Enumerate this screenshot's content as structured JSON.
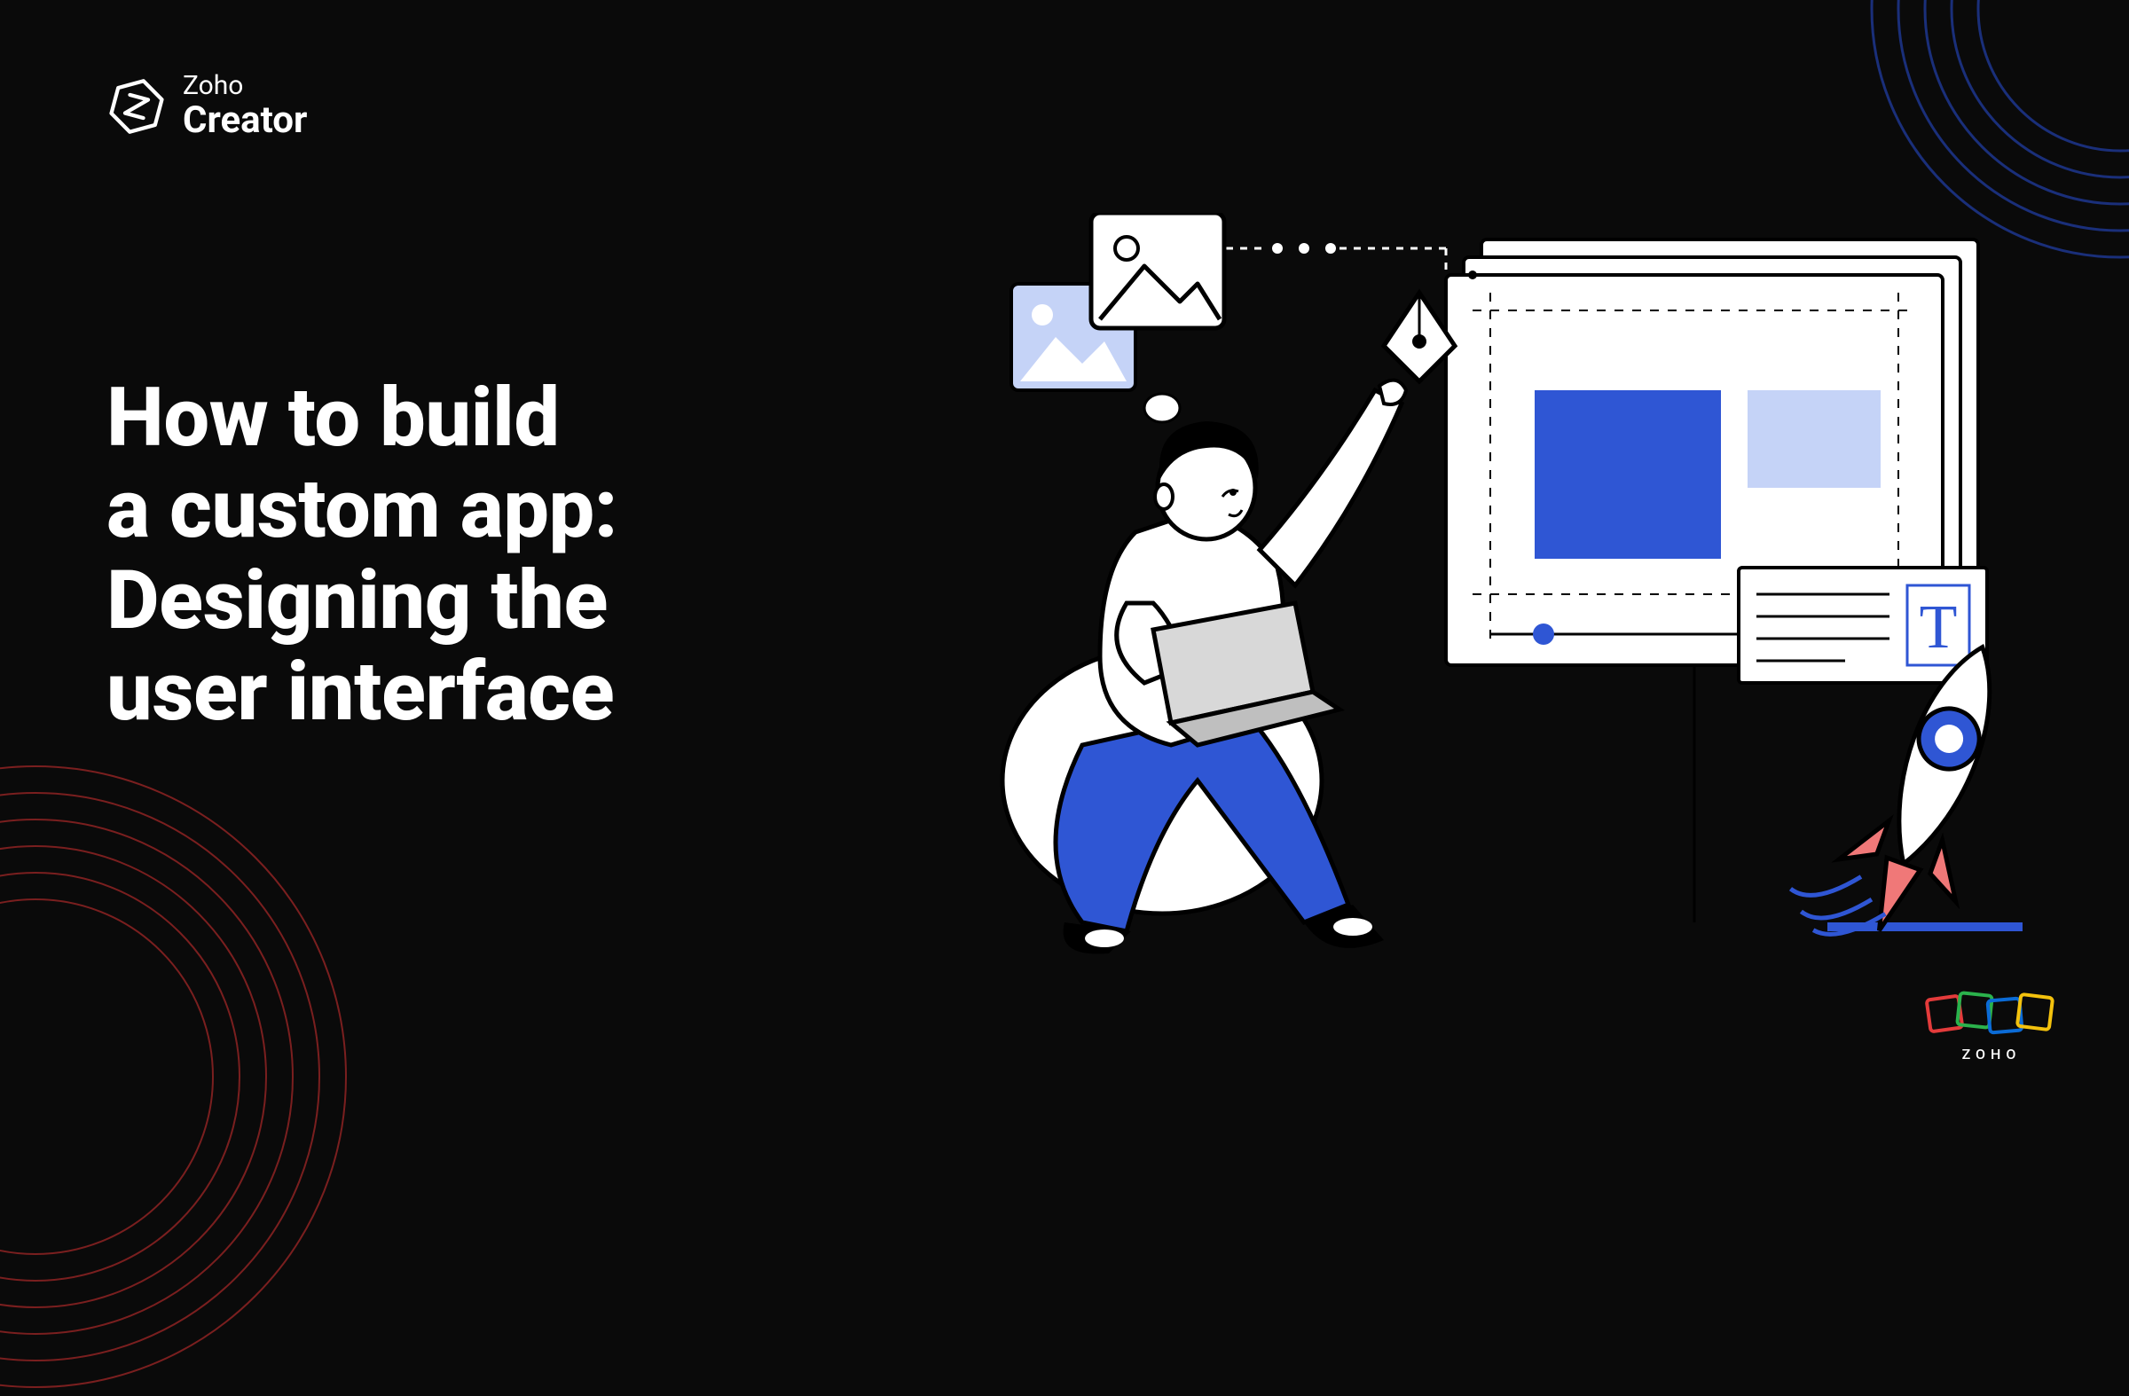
{
  "brand": {
    "top": "Zoho",
    "bottom": "Creator"
  },
  "headline": {
    "line1": "How to build",
    "line2": "a custom app:",
    "line3": "Designing the",
    "line4": "user interface"
  },
  "footer_brand": "ZOHO",
  "colors": {
    "bg": "#0a0a0a",
    "white": "#ffffff",
    "blue_primary": "#2f56d4",
    "blue_light": "#c5d3f7",
    "salmon": "#f07878",
    "red": "#e43b3b",
    "green": "#2bb24c",
    "yellow": "#f4c20d",
    "zoho_blue": "#0b6bd6"
  },
  "icons": {
    "logo": "zoho-creator-mark",
    "image_card": "image-icon",
    "pen_tool": "pen-tool-icon",
    "text_tool": "text-tool-icon",
    "rocket": "rocket-icon"
  }
}
